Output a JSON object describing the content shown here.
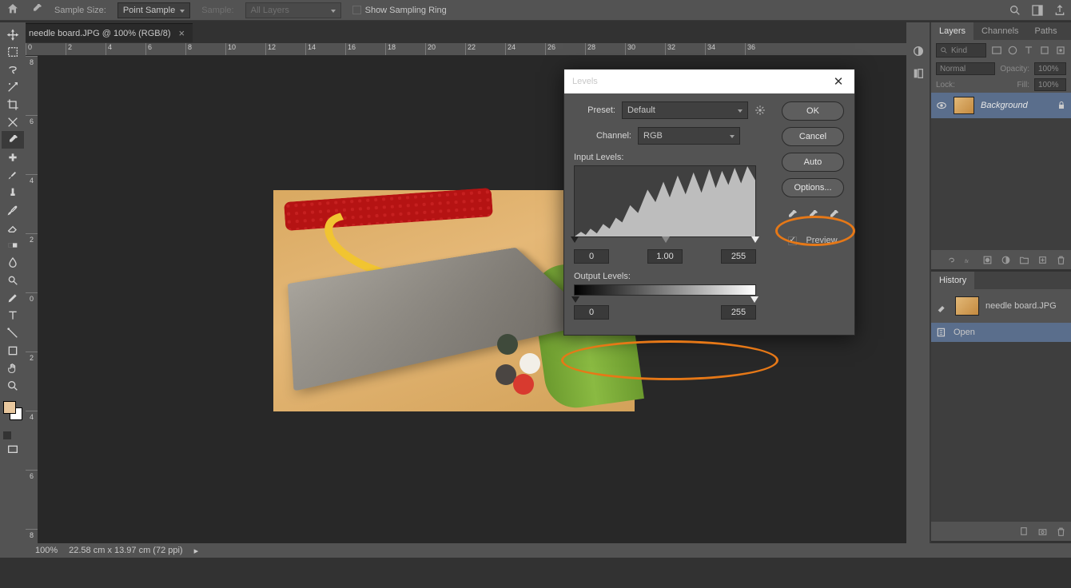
{
  "app": {
    "home": "⌂"
  },
  "options_bar": {
    "sample_size_label": "Sample Size:",
    "sample_size_value": "Point Sample",
    "sample_label": "Sample:",
    "sample_value": "All Layers",
    "show_ring": "Show Sampling Ring"
  },
  "document_tab": {
    "title": "needle board.JPG @ 100% (RGB/8)"
  },
  "ruler_h": [
    "0",
    "2",
    "4",
    "6",
    "8",
    "10",
    "12",
    "14",
    "16",
    "18",
    "20",
    "22",
    "24",
    "26",
    "28",
    "30",
    "32",
    "34",
    "36"
  ],
  "ruler_v": [
    "8",
    "6",
    "4",
    "2",
    "0",
    "2",
    "4",
    "6",
    "8"
  ],
  "tools": [
    "move",
    "marquee",
    "lasso",
    "magic",
    "crop",
    "slice",
    "eyedrop",
    "healing",
    "brush",
    "stamp",
    "history-brush",
    "eraser",
    "gradient",
    "blur",
    "dodge",
    "pen",
    "type",
    "path",
    "shape",
    "hand",
    "zoom"
  ],
  "dialog": {
    "title": "Levels",
    "preset_label": "Preset:",
    "preset_value": "Default",
    "channel_label": "Channel:",
    "channel_value": "RGB",
    "input_label": "Input Levels:",
    "output_label": "Output Levels:",
    "in_black": "0",
    "in_mid": "1.00",
    "in_white": "255",
    "out_black": "0",
    "out_white": "255",
    "ok": "OK",
    "cancel": "Cancel",
    "auto": "Auto",
    "options": "Options...",
    "preview": "Preview"
  },
  "panels": {
    "layers_tab": "Layers",
    "channels_tab": "Channels",
    "paths_tab": "Paths",
    "kind": "Kind",
    "blend_mode": "Normal",
    "opacity_label": "Opacity:",
    "opacity_value": "100%",
    "lock_label": "Lock:",
    "fill_label": "Fill:",
    "fill_value": "100%",
    "layer_name": "Background",
    "history_tab": "History",
    "history_doc": "needle board.JPG",
    "history_open": "Open"
  },
  "status": {
    "zoom": "100%",
    "doc_size": "22.58 cm x 13.97 cm (72 ppi)"
  }
}
